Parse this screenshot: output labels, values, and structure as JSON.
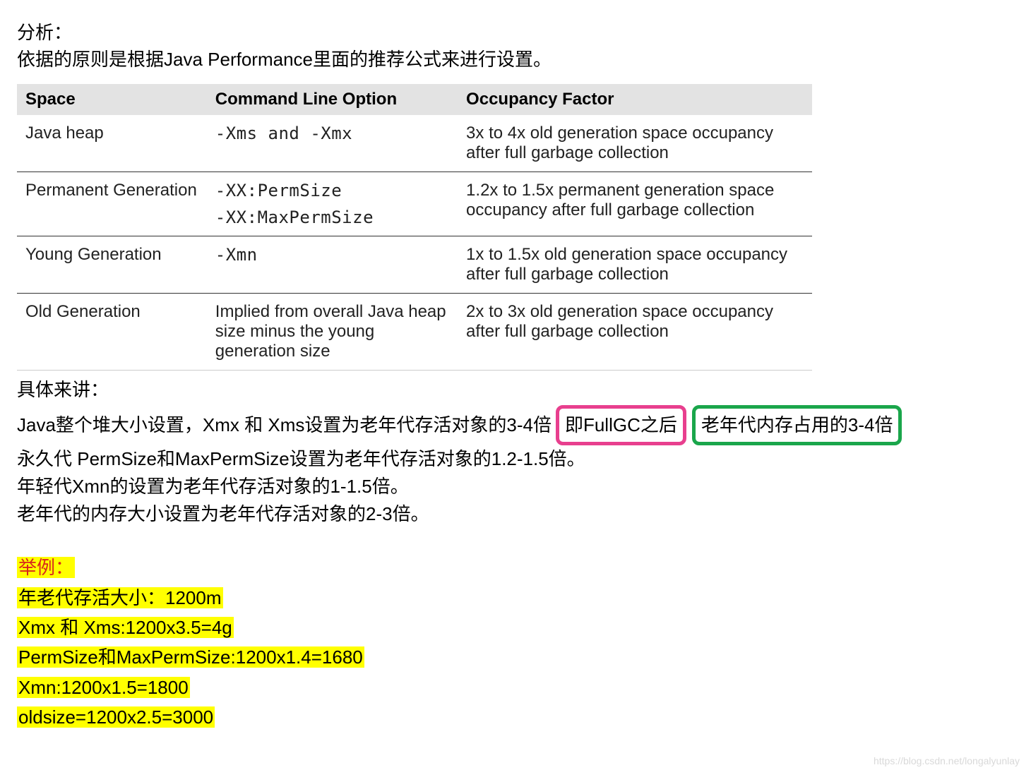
{
  "intro": {
    "line1": "分析：",
    "line2": "依据的原则是根据Java Performance里面的推荐公式来进行设置。"
  },
  "table": {
    "headers": [
      "Space",
      "Command Line Option",
      "Occupancy Factor"
    ],
    "rows": [
      {
        "space": "Java heap",
        "option": "-Xms and -Xmx",
        "option_mono": true,
        "factor": "3x to 4x old generation space occupancy after full garbage collection"
      },
      {
        "space": "Permanent Generation",
        "option_lines": [
          "-XX:PermSize",
          "-XX:MaxPermSize"
        ],
        "option_mono": true,
        "factor": "1.2x to 1.5x permanent generation space occupancy after full garbage collection"
      },
      {
        "space": "Young Generation",
        "option": "-Xmn",
        "option_mono": true,
        "factor": "1x to 1.5x old generation space occupancy after full garbage collection"
      },
      {
        "space": "Old Generation",
        "option": "Implied from overall Java heap size minus the young generation size",
        "option_mono": false,
        "factor": "2x to 3x old generation space occupancy after full garbage collection"
      }
    ]
  },
  "details": {
    "header": "具体来讲：",
    "line_heap_prefix": "Java整个堆大小设置，Xmx 和 Xms设置为老年代存活对象的3-4倍",
    "box_pink": "即FullGC之后",
    "box_green": "老年代内存占用的3-4倍",
    "line_perm": "永久代 PermSize和MaxPermSize设置为老年代存活对象的1.2-1.5倍。",
    "line_young": "年轻代Xmn的设置为老年代存活对象的1-1.5倍。",
    "line_old": "老年代的内存大小设置为老年代存活对象的2-3倍。"
  },
  "example": {
    "title": "举例：",
    "lines": [
      "年老代存活大小：1200m",
      "Xmx 和 Xms:1200x3.5=4g",
      " PermSize和MaxPermSize:1200x1.4=1680",
      "Xmn:1200x1.5=1800",
      "oldsize=1200x2.5=3000"
    ]
  },
  "watermark": "https://blog.csdn.net/longalyunlay"
}
